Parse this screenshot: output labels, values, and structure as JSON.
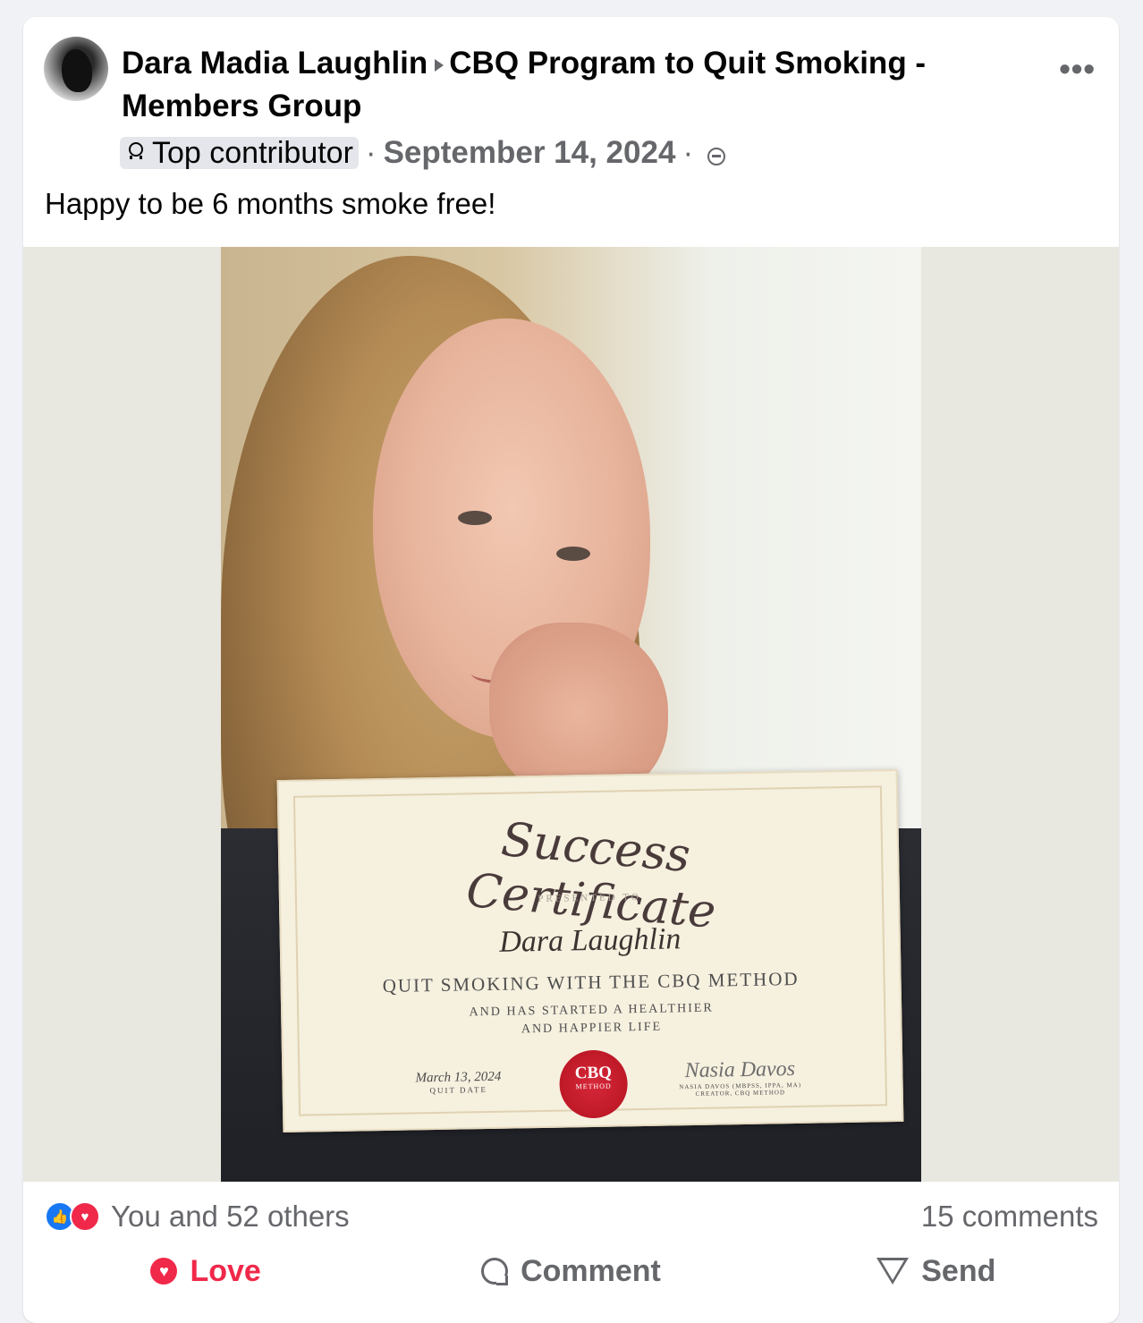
{
  "post": {
    "author": "Dara Madia Laughlin",
    "group": "CBQ Program to Quit Smoking - Members Group",
    "badge": "Top contributor",
    "date": "September 14, 2024",
    "separator": "·",
    "text": "Happy to be 6 months smoke free!",
    "more_icon": "more-icon",
    "audience_icon": "group-audience-icon"
  },
  "photo": {
    "certificate": {
      "title": "Success Certificate",
      "presented_to": "PRESENTED TO",
      "name": "Dara Laughlin",
      "method": "QUIT SMOKING WITH THE CBQ METHOD",
      "subline": "AND HAS STARTED A HEALTHIER AND HAPPIER LIFE",
      "seal_main": "CBQ",
      "seal_sub": "METHOD",
      "quit_date": "March 13, 2024",
      "quit_date_label": "QUIT DATE",
      "signature": "Nasia Davos",
      "signer": "NASIA DAVOS (MBPSS, IPPA, MA)",
      "signer_title": "CREATOR, CBQ METHOD"
    }
  },
  "reactions": {
    "summary": "You and 52 others",
    "comments": "15 comments"
  },
  "actions": {
    "love": "Love",
    "comment": "Comment",
    "send": "Send"
  },
  "colors": {
    "love": "#f02849",
    "like": "#1877f2",
    "secondary_text": "#65676b"
  }
}
